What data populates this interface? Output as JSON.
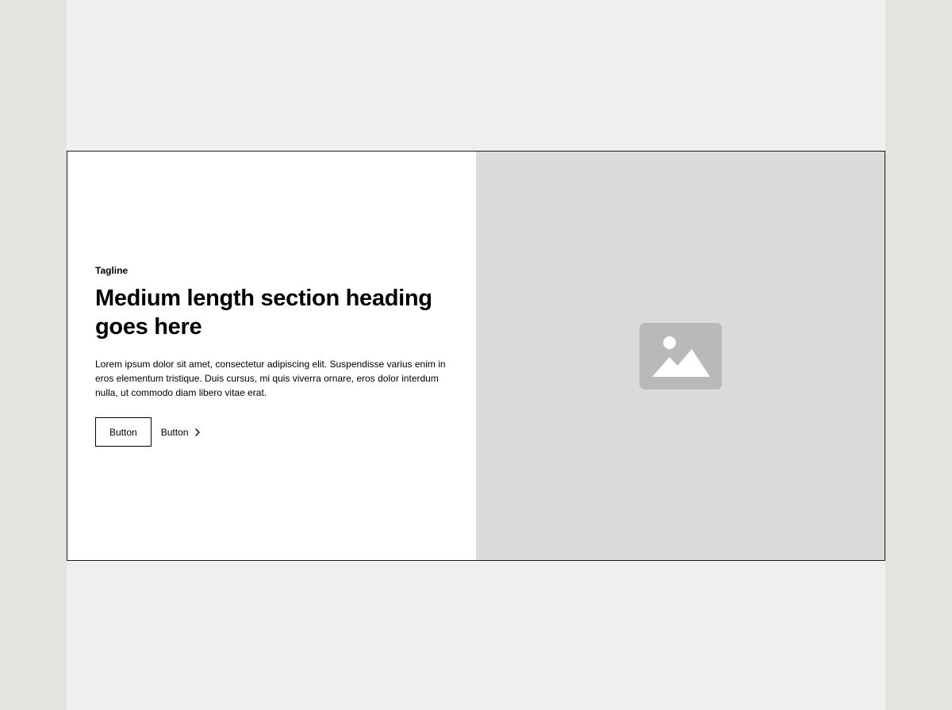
{
  "section": {
    "tagline": "Tagline",
    "heading": "Medium length section heading goes here",
    "body": "Lorem ipsum dolor sit amet, consectetur adipiscing elit. Suspendisse varius enim in eros elementum tristique. Duis cursus, mi quis viverra ornare, eros dolor interdum nulla, ut commodo diam libero vitae erat.",
    "buttons": {
      "secondary_label": "Button",
      "link_label": "Button",
      "link_icon": "chevron-right-icon"
    },
    "media": {
      "icon": "image-placeholder-icon"
    }
  },
  "colors": {
    "outer_background": "#e4e3df",
    "page_background": "#f0efed",
    "section_background": "#ffffff",
    "media_background": "#dadada",
    "placeholder_icon": "#b9b9b9",
    "text": "#000000"
  }
}
